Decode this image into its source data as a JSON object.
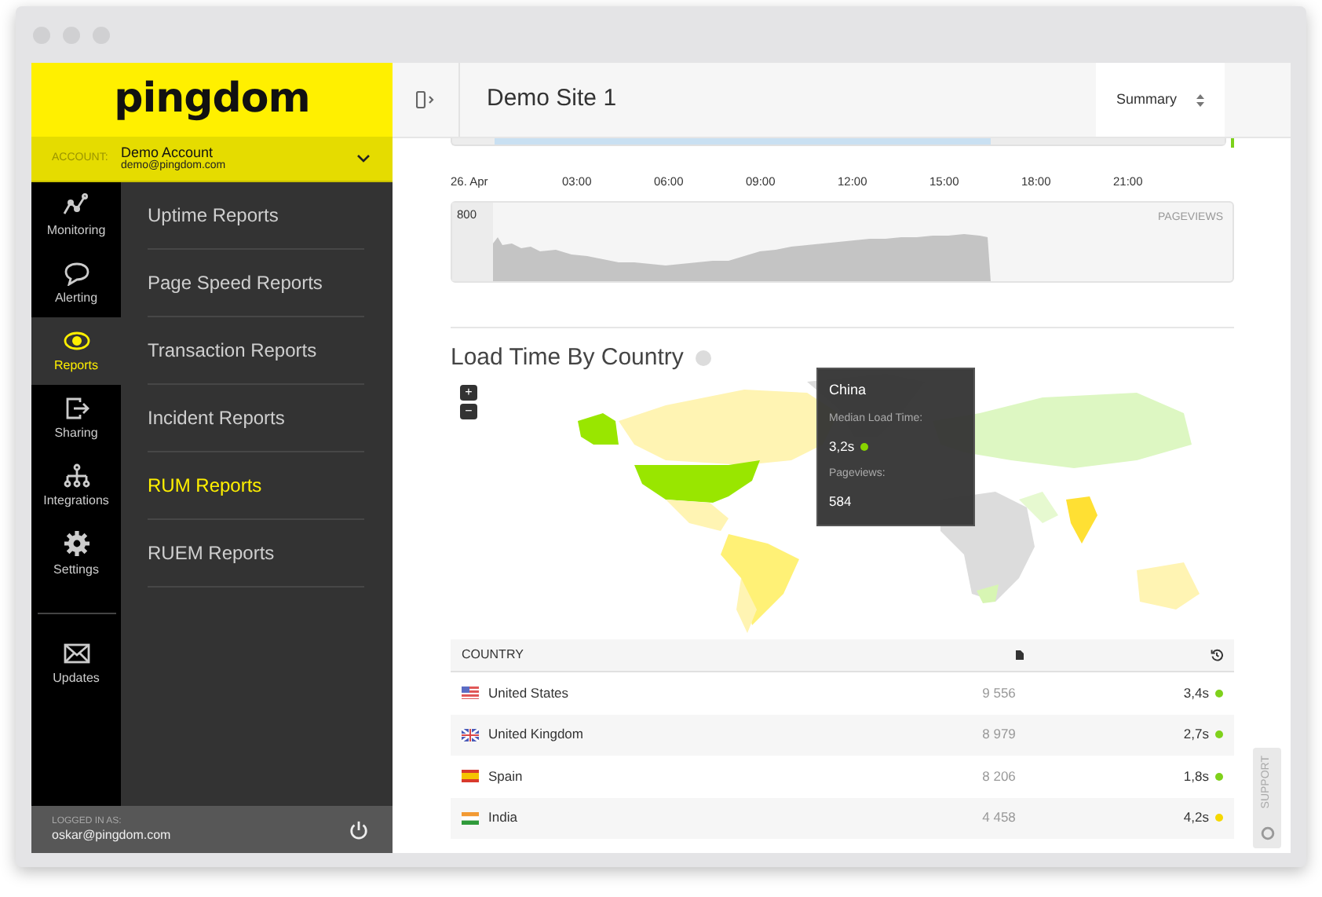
{
  "brand": {
    "logo": "pingdom"
  },
  "account": {
    "label": "ACCOUNT:",
    "name": "Demo Account",
    "email": "demo@pingdom.com"
  },
  "nav": [
    {
      "label": "Monitoring",
      "kind": "monitoring",
      "selected": false
    },
    {
      "label": "Alerting",
      "kind": "alerting",
      "selected": false
    },
    {
      "label": "Reports",
      "kind": "reports",
      "selected": true
    },
    {
      "label": "Sharing",
      "kind": "sharing",
      "selected": false
    },
    {
      "label": "Integrations",
      "kind": "integrations",
      "selected": false
    },
    {
      "label": "Settings",
      "kind": "settings",
      "selected": false
    }
  ],
  "nav_bottom": [
    {
      "label": "Updates",
      "kind": "updates",
      "selected": false
    }
  ],
  "menu": [
    {
      "label": "Uptime Reports",
      "selected": false
    },
    {
      "label": "Page Speed Reports",
      "selected": false
    },
    {
      "label": "Transaction Reports",
      "selected": false
    },
    {
      "label": "Incident Reports",
      "selected": false
    },
    {
      "label": "RUM Reports",
      "selected": true
    },
    {
      "label": "RUEM Reports",
      "selected": false
    }
  ],
  "login": {
    "label": "LOGGED IN AS:",
    "email": "oskar@pingdom.com"
  },
  "header": {
    "title": "Demo Site 1",
    "select": "Summary"
  },
  "timeline": {
    "ticks": [
      "26. Apr",
      "03:00",
      "06:00",
      "09:00",
      "12:00",
      "15:00",
      "18:00",
      "21:00"
    ],
    "level": 0.68
  },
  "pageviews_chart": {
    "max_label": "800",
    "label": "PAGEVIEWS"
  },
  "map_section": {
    "title": "Load Time By Country",
    "zoom_in": "+",
    "zoom_out": "−",
    "tooltip": {
      "country": "China",
      "load_label": "Median Load Time:",
      "load": "3,2s",
      "color": "#88d400",
      "views_label": "Pageviews:",
      "views": "584"
    }
  },
  "table": {
    "columns": [
      "COUNTRY"
    ],
    "rows": [
      {
        "kind": "us",
        "country": "United States",
        "pageviews": "9 556",
        "load": "3,4s",
        "color": "#7fd11b"
      },
      {
        "kind": "gb",
        "country": "United Kingdom",
        "pageviews": "8 979",
        "load": "2,7s",
        "color": "#7fd11b"
      },
      {
        "kind": "es",
        "country": "Spain",
        "pageviews": "8 206",
        "load": "1,8s",
        "color": "#7fd11b"
      },
      {
        "kind": "in",
        "country": "India",
        "pageviews": "4 458",
        "load": "4,2s",
        "color": "#f5d800"
      }
    ]
  },
  "support": {
    "label": "SUPPORT"
  }
}
